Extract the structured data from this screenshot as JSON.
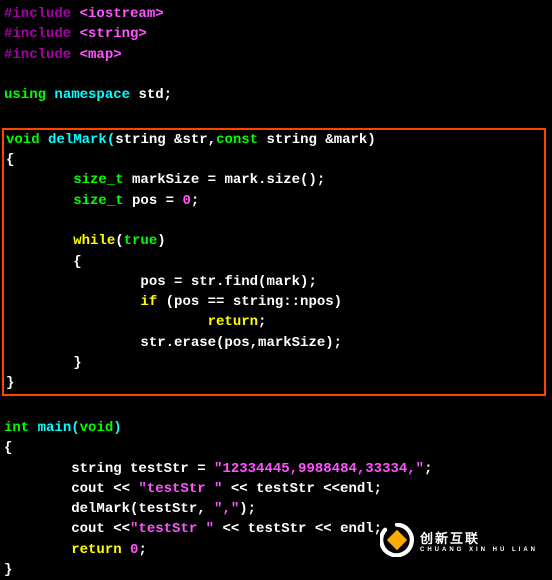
{
  "code": {
    "line1_include": "#include",
    "line1_header": "<iostream>",
    "line2_include": "#include",
    "line2_header": "<string>",
    "line3_include": "#include",
    "line3_header": "<map>",
    "line5_using": "using",
    "line5_namespace": "namespace",
    "line5_std": " std;",
    "line7_void": "void",
    "line7_fname": " delMark(",
    "line7_string1": "string",
    "line7_arg1": " &str,",
    "line7_const": "const",
    "line7_string2": " string",
    "line7_arg2": " &mark)",
    "line8_brace": "{",
    "line9_sizet": "        size_t",
    "line9_rest": " markSize = mark.size();",
    "line10_sizet": "        size_t",
    "line10_rest": " pos = ",
    "line10_zero": "0",
    "line10_semi": ";",
    "line12_while": "        while",
    "line12_paren": "(",
    "line12_true": "true",
    "line12_close": ")",
    "line13_brace": "        {",
    "line14_pos": "                pos = str.find(mark);",
    "line15_if": "                if",
    "line15_cond": " (pos == string::npos)",
    "line16_return": "                        return",
    "line16_semi": ";",
    "line17_erase": "                str.erase(pos,markSize);",
    "line18_brace": "        }",
    "line19_brace": "}",
    "line21_int": "int",
    "line21_main": " main(",
    "line21_void": "void",
    "line21_close": ")",
    "line22_brace": "{",
    "line23_string": "        string",
    "line23_var": " testStr = ",
    "line23_literal": "\"12334445,9988484,33334,\"",
    "line23_semi": ";",
    "line24_cout": "        cout << ",
    "line24_str": "\"testStr \"",
    "line24_rest": " << testStr <<endl;",
    "line25_delmark": "        delMark(testStr, ",
    "line25_comma": "\",\"",
    "line25_close": ");",
    "line26_cout": "        cout <<",
    "line26_str": "\"testStr \"",
    "line26_rest": " << testStr << endl;",
    "line27_return": "        return",
    "line27_zero": " 0",
    "line27_semi": ";",
    "line28_brace": "}",
    "line29_empty": ""
  },
  "logo": {
    "main": "创新互联",
    "sub": "CHUANG XIN HU LIAN"
  }
}
